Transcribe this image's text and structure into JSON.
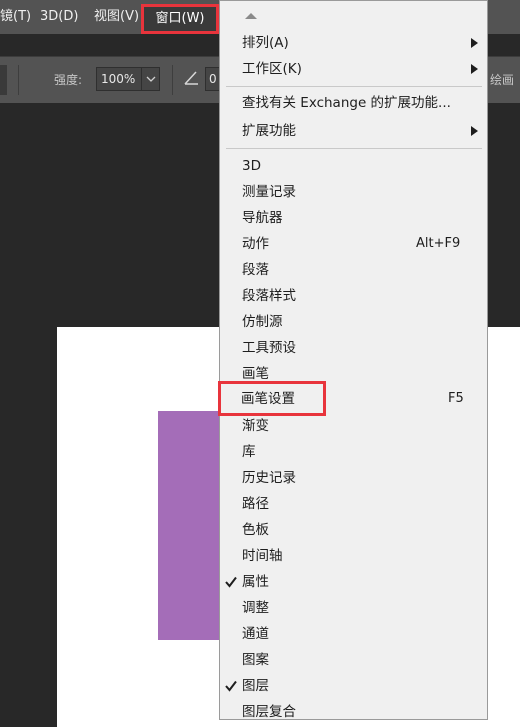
{
  "menubar": {
    "items": [
      "镜(T)",
      "3D(D)",
      "视图(V)"
    ],
    "active": "窗口(W)"
  },
  "options": {
    "strength_label": "强度:",
    "strength_value": "100%",
    "angle_value": "0",
    "paint_label": "绘画"
  },
  "dropdown": {
    "group1": [
      {
        "label": "排列(A)",
        "submenu": true
      },
      {
        "label": "工作区(K)",
        "submenu": true
      }
    ],
    "group2": [
      {
        "label": "查找有关 Exchange 的扩展功能...",
        "submenu": false
      },
      {
        "label": "扩展功能",
        "submenu": true
      }
    ],
    "items": [
      {
        "label": "3D"
      },
      {
        "label": "测量记录"
      },
      {
        "label": "导航器"
      },
      {
        "label": "动作",
        "shortcut": "Alt+F9"
      },
      {
        "label": "段落"
      },
      {
        "label": "段落样式"
      },
      {
        "label": "仿制源"
      },
      {
        "label": "工具预设"
      },
      {
        "label": "画笔"
      },
      {
        "label": "画笔设置",
        "shortcut": "F5"
      },
      {
        "label": "渐变"
      },
      {
        "label": "库"
      },
      {
        "label": "历史记录"
      },
      {
        "label": "路径"
      },
      {
        "label": "色板"
      },
      {
        "label": "时间轴"
      },
      {
        "label": "属性",
        "checked": true
      },
      {
        "label": "调整"
      },
      {
        "label": "通道"
      },
      {
        "label": "图案"
      },
      {
        "label": "图层",
        "checked": true
      },
      {
        "label": "图层复合"
      }
    ]
  },
  "colors": {
    "highlight": "#e8343c",
    "menu_bg": "#535353",
    "dropdown_bg": "#f0f0f0",
    "swatch": "#a46db8"
  }
}
